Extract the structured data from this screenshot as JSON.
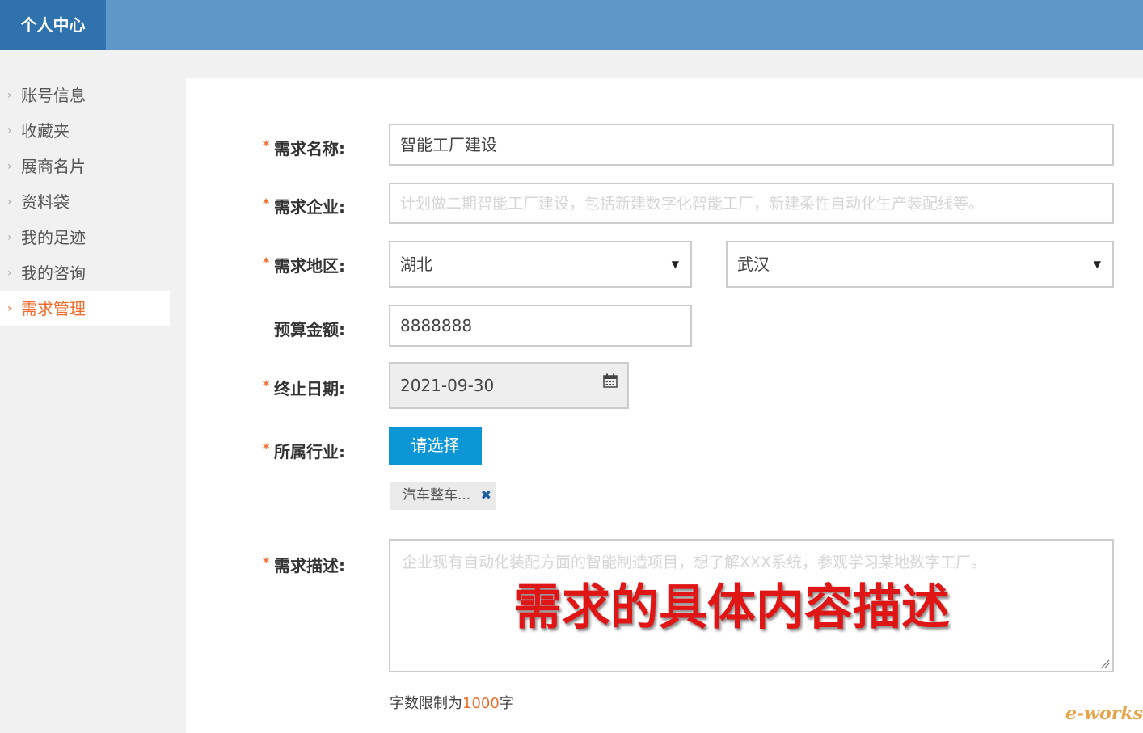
{
  "header": {
    "title": "个人中心"
  },
  "sidebar": {
    "items": [
      {
        "label": "账号信息"
      },
      {
        "label": "收藏夹"
      },
      {
        "label": "展商名片"
      },
      {
        "label": "资料袋"
      },
      {
        "label": "我的足迹"
      },
      {
        "label": "我的咨询"
      },
      {
        "label": "需求管理",
        "active": true
      }
    ]
  },
  "form": {
    "required_mark": "*",
    "name": {
      "label": "需求名称:",
      "value": "智能工厂建设"
    },
    "company": {
      "label": "需求企业:",
      "placeholder": "计划做二期智能工厂建设，包括新建数字化智能工厂，新建柔性自动化生产装配线等。"
    },
    "region": {
      "label": "需求地区:",
      "province": "湖北",
      "city": "武汉"
    },
    "budget": {
      "label": "预算金额:",
      "value": "8888888"
    },
    "end_date": {
      "label": "终止日期:",
      "value": "2021-09-30"
    },
    "industry": {
      "label": "所属行业:",
      "button": "请选择",
      "tag": "汽车整车...",
      "remove": "✖"
    },
    "description": {
      "label": "需求描述:",
      "placeholder": "企业现有自动化装配方面的智能制造项目，想了解XXX系统，参观学习某地数字工厂。",
      "overlay": "需求的具体内容描述"
    },
    "limit": {
      "prefix": "字数限制为",
      "count": "1000",
      "suffix": "字"
    }
  },
  "watermark": "e-works",
  "colors": {
    "accent": "#f06d2c",
    "primary_button": "#0d96d5",
    "header": "#5e98c8",
    "brand": "#2f72ad"
  }
}
